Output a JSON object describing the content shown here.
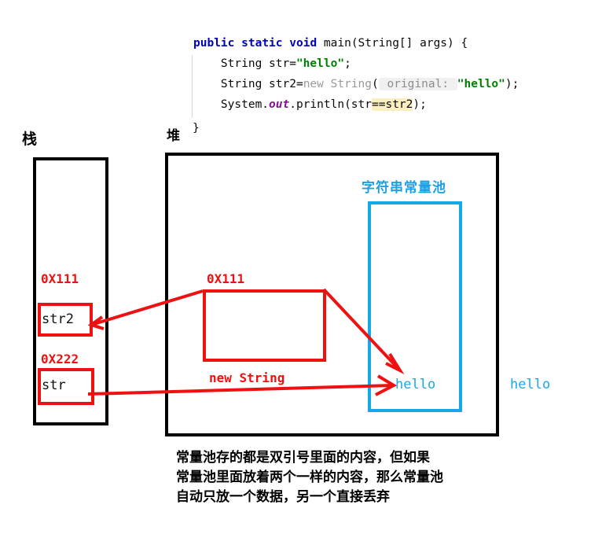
{
  "code": {
    "lines": [
      [
        {
          "t": "public",
          "c": "kw"
        },
        {
          "t": " ",
          "c": "plain"
        },
        {
          "t": "static",
          "c": "kw"
        },
        {
          "t": " ",
          "c": "plain"
        },
        {
          "t": "void",
          "c": "kw"
        },
        {
          "t": " ",
          "c": "plain"
        },
        {
          "t": "main(String[] args) {",
          "c": "plain"
        }
      ],
      [
        {
          "t": "    String str=",
          "c": "plain"
        },
        {
          "t": "\"hello\"",
          "c": "str"
        },
        {
          "t": ";",
          "c": "plain"
        }
      ],
      [
        {
          "t": "    String str2=",
          "c": "plain"
        },
        {
          "t": "new",
          "c": "dim"
        },
        {
          "t": " ",
          "c": "plain"
        },
        {
          "t": "String",
          "c": "dim"
        },
        {
          "t": "(",
          "c": "plain"
        },
        {
          "t": " original: ",
          "c": "hint"
        },
        {
          "t": "\"hello\"",
          "c": "str"
        },
        {
          "t": ");",
          "c": "plain"
        }
      ],
      [
        {
          "t": "    System.",
          "c": "plain"
        },
        {
          "t": "out",
          "c": "field"
        },
        {
          "t": ".println(str",
          "c": "plain"
        },
        {
          "t": "==",
          "c": "hl"
        },
        {
          "t": "str2",
          "c": "hl"
        },
        {
          "t": ");",
          "c": "plain"
        }
      ]
    ],
    "closing_brace": "}"
  },
  "labels": {
    "stack": "栈",
    "heap": "堆",
    "constant_pool": "字符串常量池"
  },
  "stack": {
    "address_1": "0X111",
    "var_1": "str2",
    "address_2": "0X222",
    "var_2": "str"
  },
  "heap": {
    "address": "0X111",
    "object_caption": "new String"
  },
  "pool": {
    "value": "hello"
  },
  "outer": {
    "value": "hello"
  },
  "note": {
    "line1": "常量池存的都是双引号里面的内容，但如果",
    "line2": "常量池里面放着两个一样的内容，那么常量池",
    "line3": "自动只放一个数据，另一个直接丢弃"
  },
  "colors": {
    "red": "#ee1111",
    "blue": "#17a8e8",
    "black": "#000000",
    "code_keyword": "#0000c0",
    "code_string": "#008000",
    "code_field": "#871094",
    "code_highlight": "#fbeec1"
  }
}
